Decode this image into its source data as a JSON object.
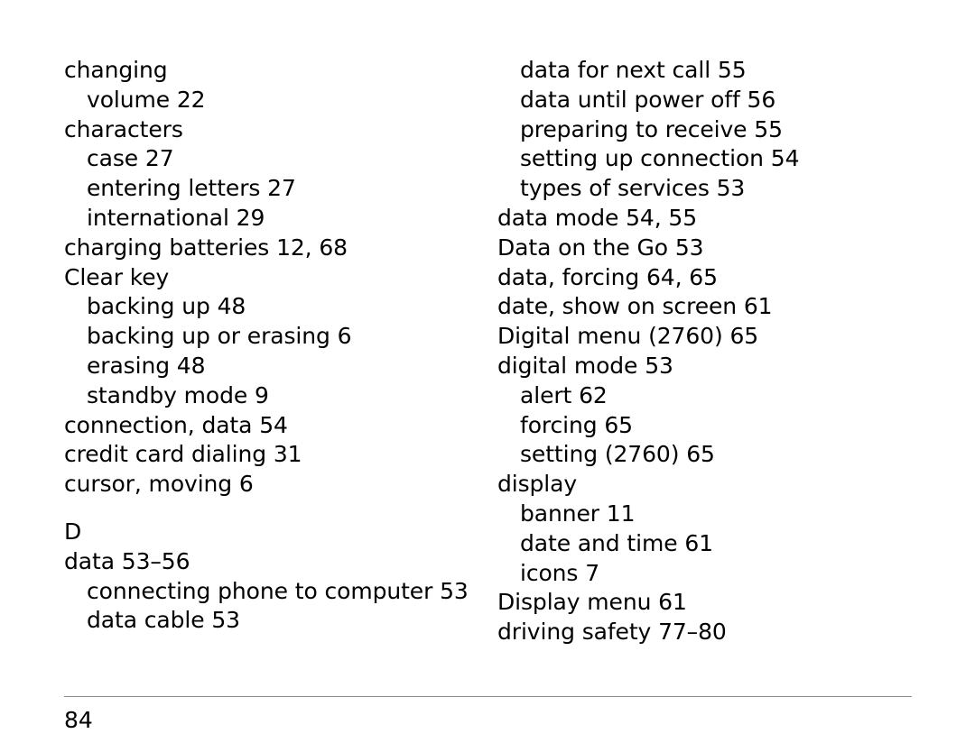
{
  "document": {
    "type": "book-index-page",
    "page_number": "84",
    "background_color": "#ffffff",
    "text_color": "#000000",
    "rule_color": "#8c8c8c"
  },
  "left_column": {
    "entries": [
      {
        "text": "changing",
        "level": 0
      },
      {
        "text": "volume 22",
        "level": 1
      },
      {
        "text": "characters",
        "level": 0
      },
      {
        "text": "case 27",
        "level": 1
      },
      {
        "text": "entering letters 27",
        "level": 1
      },
      {
        "text": "international 29",
        "level": 1
      },
      {
        "text": "charging batteries 12, 68",
        "level": 0
      },
      {
        "text": "Clear key",
        "level": 0
      },
      {
        "text": "backing up 48",
        "level": 1
      },
      {
        "text": "backing up or erasing 6",
        "level": 1
      },
      {
        "text": "erasing 48",
        "level": 1
      },
      {
        "text": "standby mode 9",
        "level": 1
      },
      {
        "text": "connection, data 54",
        "level": 0
      },
      {
        "text": "credit card dialing 31",
        "level": 0
      },
      {
        "text": "cursor, moving 6",
        "level": 0
      }
    ],
    "section_letter": "D",
    "entries_after_section": [
      {
        "text": "data 53–56",
        "level": 0
      },
      {
        "text": "connecting phone to computer 53",
        "level": 1
      },
      {
        "text": "data cable 53",
        "level": 1
      }
    ]
  },
  "right_column": {
    "entries": [
      {
        "text": "data for next call 55",
        "level": 1
      },
      {
        "text": "data until power off 56",
        "level": 1
      },
      {
        "text": "preparing to receive 55",
        "level": 1
      },
      {
        "text": "setting up connection 54",
        "level": 1
      },
      {
        "text": "types of services 53",
        "level": 1
      },
      {
        "text": "data mode 54, 55",
        "level": 0
      },
      {
        "text": "Data on the Go 53",
        "level": 0
      },
      {
        "text": "data, forcing 64, 65",
        "level": 0
      },
      {
        "text": "date, show on screen 61",
        "level": 0
      },
      {
        "text": "Digital menu (2760) 65",
        "level": 0
      },
      {
        "text": "digital mode 53",
        "level": 0
      },
      {
        "text": "alert 62",
        "level": 1
      },
      {
        "text": "forcing 65",
        "level": 1
      },
      {
        "text": "setting (2760) 65",
        "level": 1
      },
      {
        "text": "display",
        "level": 0
      },
      {
        "text": "banner 11",
        "level": 1
      },
      {
        "text": "date and time 61",
        "level": 1
      },
      {
        "text": "icons 7",
        "level": 1
      },
      {
        "text": "Display menu 61",
        "level": 0
      },
      {
        "text": "driving safety 77–80",
        "level": 0
      }
    ]
  }
}
